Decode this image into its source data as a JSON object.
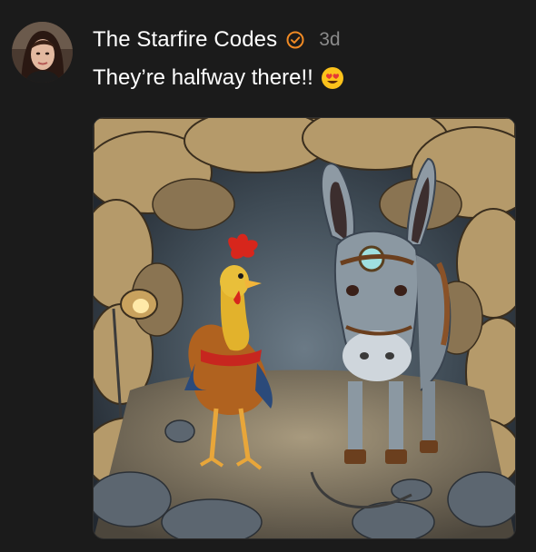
{
  "post": {
    "author_name": "The Starfire Codes",
    "verified_icon": "verified-badge-icon",
    "time": "3d",
    "text": "They’re halfway there!!",
    "emoji_icon": "heart-eyes-emoji-icon",
    "accent_color": "#f08a24",
    "image": {
      "subject": "rooster-and-donkey-in-cave-illustration"
    }
  }
}
